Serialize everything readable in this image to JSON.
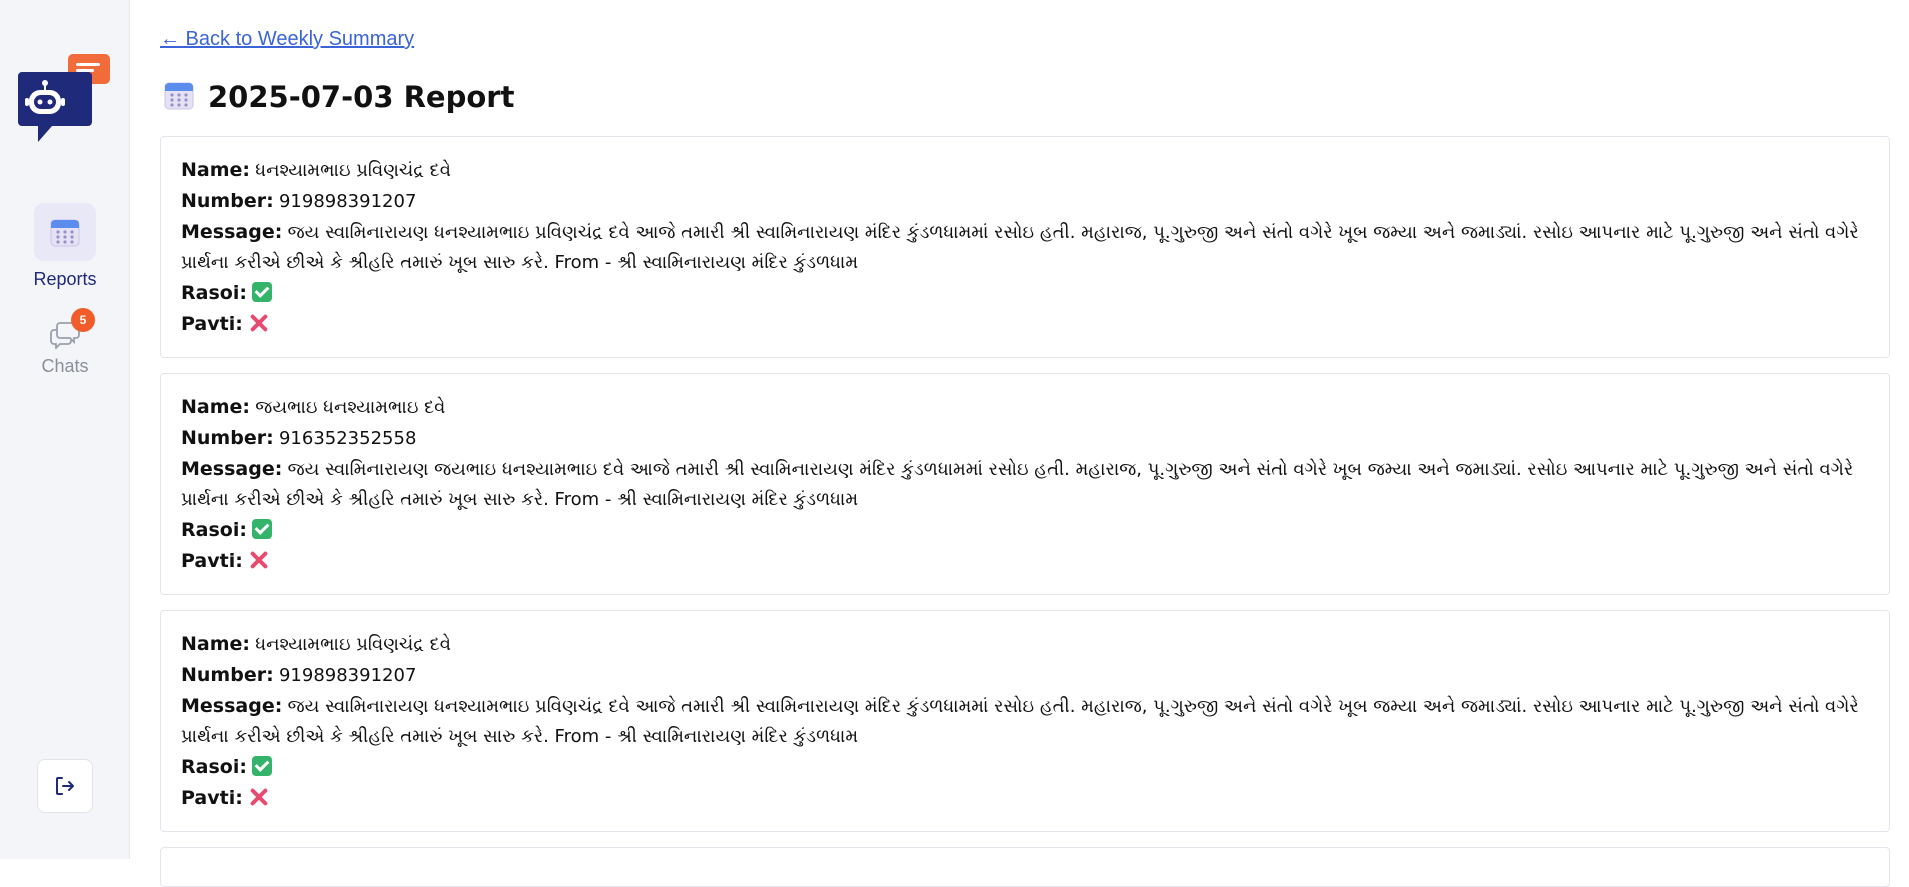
{
  "sidebar": {
    "logo_icon": "chatbot-logo-icon",
    "nav": [
      {
        "label": "Reports",
        "icon": "calendar-icon",
        "active": true
      },
      {
        "label": "Chats",
        "icon": "chat-bubbles-icon",
        "badge": "5",
        "active": false
      }
    ],
    "logout_icon": "logout-icon"
  },
  "header": {
    "back_link": "← Back to Weekly Summary",
    "title_icon": "calendar-icon",
    "title": "2025-07-03 Report"
  },
  "labels": {
    "name": "Name:",
    "number": "Number:",
    "message": "Message:",
    "rasoi": "Rasoi:",
    "pavti": "Pavti:"
  },
  "reports": [
    {
      "name": "ધનશ્યામભાઇ પ્રવિણચંદ્ર દવે",
      "number": "919898391207",
      "message": "જય સ્વામિનારાયણ ધનશ્યામભાઇ પ્રવિણચંદ્ર દવે આજે તમારી શ્રી સ્વામિનારાયણ મંદિર કુંડળધામમાં રસોઇ હતી. મહારાજ, પૂ.ગુરુજી અને સંતો વગેરે ખૂબ જમ્યા અને જમાડ્યાં. રસોઇ આપનાર માટે પૂ.ગુરુજી અને સંતો વગેરે પ્રાર્થના કરીએ છીએ કે શ્રીહરિ તમારું ખૂબ સારુ કરે. From - શ્રી સ્વામિનારાયણ મંદિર કુંડળધામ",
      "rasoi": "yes",
      "pavti": "no"
    },
    {
      "name": "જયભાઇ ધનશ્યામભાઇ દવે",
      "number": "916352352558",
      "message": "જય સ્વામિનારાયણ જયભાઇ ધનશ્યામભાઇ દવે આજે તમારી શ્રી સ્વામિનારાયણ મંદિર કુંડળધામમાં રસોઇ હતી. મહારાજ, પૂ.ગુરુજી અને સંતો વગેરે ખૂબ જમ્યા અને જમાડ્યાં. રસોઇ આપનાર માટે પૂ.ગુરુજી અને સંતો વગેરે પ્રાર્થના કરીએ છીએ કે શ્રીહરિ તમારું ખૂબ સારુ કરે. From - શ્રી સ્વામિનારાયણ મંદિર કુંડળધામ",
      "rasoi": "yes",
      "pavti": "no"
    },
    {
      "name": "ધનશ્યામભાઇ પ્રવિણચંદ્ર દવે",
      "number": "919898391207",
      "message": "જય સ્વામિનારાયણ ધનશ્યામભાઇ પ્રવિણચંદ્ર દવે આજે તમારી શ્રી સ્વામિનારાયણ મંદિર કુંડળધામમાં રસોઇ હતી. મહારાજ, પૂ.ગુરુજી અને સંતો વગેરે ખૂબ જમ્યા અને જમાડ્યાં. રસોઇ આપનાર માટે પૂ.ગુરુજી અને સંતો વગેરે પ્રાર્થના કરીએ છીએ કે શ્રીહરિ તમારું ખૂબ સારુ કરે. From - શ્રી સ્વામિનારાયણ મંદિર કુંડળધામ",
      "rasoi": "yes",
      "pavti": "no"
    }
  ]
}
